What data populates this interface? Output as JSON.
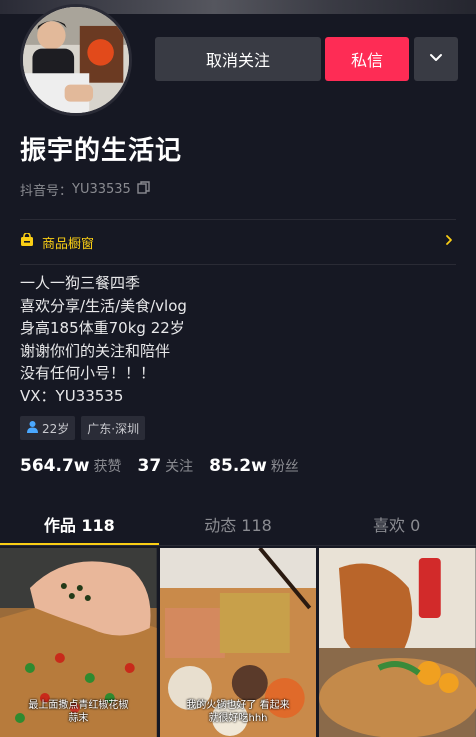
{
  "profile": {
    "name": "振宇的生活记",
    "douyin_id_label": "抖音号：",
    "douyin_id": "YU33535"
  },
  "actions": {
    "unfollow_label": "取消关注",
    "message_label": "私信"
  },
  "shop": {
    "label": "商品橱窗"
  },
  "bio": {
    "lines": [
      "一人一狗三餐四季",
      "喜欢分享/生活/美食/vlog",
      "身高185体重70kg 22岁",
      "谢谢你们的关注和陪伴",
      "没有任何小号！！！",
      "VX：YU33535"
    ]
  },
  "tags": {
    "age": "22岁",
    "location": "广东·深圳"
  },
  "stats": {
    "likes_value": "564.7w",
    "likes_label": "获赞",
    "following_value": "37",
    "following_label": "关注",
    "followers_value": "85.2w",
    "followers_label": "粉丝"
  },
  "tabs": [
    {
      "label": "作品 118",
      "active": true
    },
    {
      "label": "动态 118",
      "active": false
    },
    {
      "label": "喜欢 0",
      "active": false
    }
  ],
  "videos": [
    {
      "caption": "最上面撒点青红椒花椒蒜末"
    },
    {
      "caption": "我的火锅也好了 看起来就很好吃hhh"
    },
    {
      "caption": ""
    }
  ],
  "colors": {
    "background": "#161823",
    "accent_red": "#fe2c55",
    "accent_yellow": "#face15",
    "button_gray": "#393b44",
    "muted_text": "#8a8b91"
  },
  "icons": {
    "copy": "copy-icon",
    "shop": "shop-icon",
    "chevron_right": "chevron-right-icon",
    "chevron_down": "chevron-down-icon",
    "person": "person-icon"
  }
}
